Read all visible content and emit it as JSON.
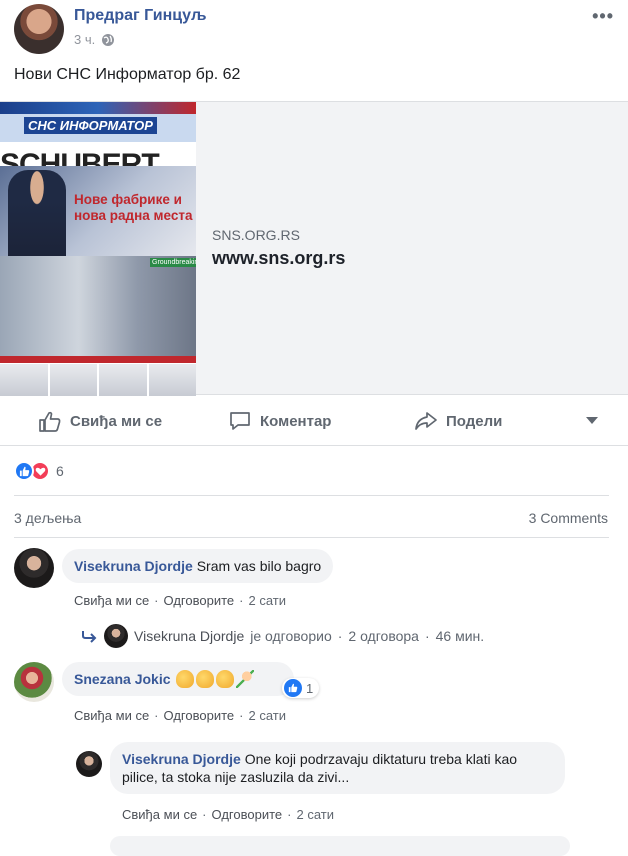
{
  "post": {
    "author": "Предраг Гинцуљ",
    "time": "3 ч.",
    "more_label": "•••",
    "text": "Нови СНС Информатор бр. 62"
  },
  "link_preview": {
    "domain": "SNS.ORG.RS",
    "title": "www.sns.org.rs",
    "newspaper": {
      "masthead": "СНС ИНФОРМАТОР",
      "big_word": "SCHUBERT",
      "headline": "Нове фабрике и нова радна места",
      "tag": "Groundbreaking"
    }
  },
  "actions": {
    "like": "Свиђа ми се",
    "comment": "Коментар",
    "share": "Подели"
  },
  "stats": {
    "reactions_count": "6",
    "shares": "3 дељења",
    "comments": "3 Comments"
  },
  "comments": [
    {
      "author": "Visekruna Djordje",
      "text": "Sram vas bilo bagro",
      "like_label": "Свиђа ми се",
      "reply_label": "Одговорите",
      "time": "2 сати",
      "replies_summary": {
        "author": "Visekruna Djordje",
        "text": "је одговорио",
        "count": "2 одговора",
        "time": "46 мин."
      }
    },
    {
      "author": "Snezana Jokic",
      "text": "",
      "like_count": "1",
      "like_label": "Свиђа ми се",
      "reply_label": "Одговорите",
      "time": "2 сати"
    },
    {
      "author": "Visekruna Djordje",
      "text": "One koji podrzavaju diktaturu treba klati kao pilice, ta stoka nije zasluzila da zivi...",
      "like_label": "Свиђа ми се",
      "reply_label": "Одговорите",
      "time": "2 сати"
    }
  ],
  "separator": "·",
  "colors": {
    "link_blue": "#385898",
    "like_blue": "#2078f4",
    "love_red": "#f33e58",
    "bubble_bg": "#f2f3f5"
  }
}
